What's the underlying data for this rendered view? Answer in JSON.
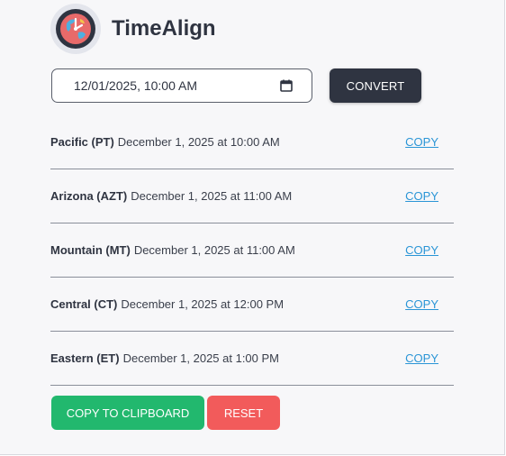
{
  "app": {
    "name": "TimeAlign"
  },
  "input": {
    "datetime_value": "12/01/2025, 10:00 AM"
  },
  "buttons": {
    "convert": "CONVERT",
    "copy_clipboard": "COPY TO CLIPBOARD",
    "reset": "RESET"
  },
  "zones": [
    {
      "name": "Pacific (PT)",
      "time": "December 1, 2025 at 10:00 AM",
      "copy": "COPY"
    },
    {
      "name": "Arizona (AZT)",
      "time": "December 1, 2025 at 11:00 AM",
      "copy": "COPY"
    },
    {
      "name": "Mountain (MT)",
      "time": "December 1, 2025 at 11:00 AM",
      "copy": "COPY"
    },
    {
      "name": "Central (CT)",
      "time": "December 1, 2025 at 12:00 PM",
      "copy": "COPY"
    },
    {
      "name": "Eastern (ET)",
      "time": "December 1, 2025 at 1:00 PM",
      "copy": "COPY"
    }
  ],
  "icons": {
    "logo": "world-clock-icon",
    "calendar": "calendar-icon"
  },
  "colors": {
    "dark": "#2f3441",
    "green": "#22b86e",
    "red": "#f25b5b",
    "link": "#2a95d6"
  }
}
